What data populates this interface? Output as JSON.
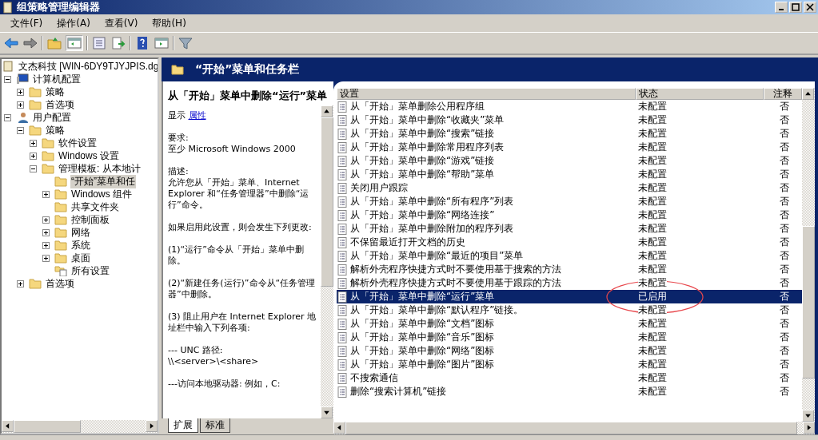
{
  "window": {
    "title": "组策略管理编辑器"
  },
  "menu": [
    "文件(F)",
    "操作(A)",
    "查看(V)",
    "帮助(H)"
  ],
  "tree": [
    {
      "label": "文杰科技 [WIN-6DY9TJYJPIS.dg",
      "kind": "scroll",
      "selected": false,
      "children": [
        {
          "label": "计算机配置",
          "kind": "computer",
          "expanded": true,
          "selected": false,
          "children": [
            {
              "label": "策略",
              "expanded": false,
              "selected": false
            },
            {
              "label": "首选项",
              "expanded": false,
              "selected": false
            }
          ]
        },
        {
          "label": "用户配置",
          "kind": "user",
          "expanded": true,
          "selected": false,
          "children": [
            {
              "label": "策略",
              "expanded": true,
              "selected": false,
              "children": [
                {
                  "label": "软件设置",
                  "expanded": false,
                  "selected": false
                },
                {
                  "label": "Windows 设置",
                  "expanded": false,
                  "selected": false
                },
                {
                  "label": "管理模板: 从本地计",
                  "expanded": true,
                  "selected": false,
                  "children": [
                    {
                      "label": "“开始”菜单和任",
                      "selected": true
                    },
                    {
                      "label": "Windows 组件",
                      "expanded": false,
                      "selected": false
                    },
                    {
                      "label": "共享文件夹",
                      "selected": false
                    },
                    {
                      "label": "控制面板",
                      "expanded": false,
                      "selected": false
                    },
                    {
                      "label": "网络",
                      "expanded": false,
                      "selected": false
                    },
                    {
                      "label": "系统",
                      "expanded": false,
                      "selected": false
                    },
                    {
                      "label": "桌面",
                      "expanded": false,
                      "selected": false
                    },
                    {
                      "label": "所有设置",
                      "kind": "allsettings",
                      "selected": false
                    }
                  ]
                }
              ]
            },
            {
              "label": "首选项",
              "expanded": false,
              "selected": false
            }
          ]
        }
      ]
    }
  ],
  "header": {
    "title": "“开始”菜单和任务栏"
  },
  "description": {
    "title": "从「开始」菜单中删除“运行”菜单",
    "show_label": "显示",
    "show_link": "属性",
    "paragraphs": [
      "要求:\n至少 Microsoft Windows 2000",
      "描述:\n允许您从「开始」菜单、Internet Explorer 和“任务管理器”中删除“运行”命令。",
      "如果启用此设置，则会发生下列更改:",
      "(1)“运行”命令从「开始」菜单中删除。",
      "(2)“新建任务(运行)”命令从“任务管理器”中删除。",
      "(3) 阻止用户在 Internet Explorer 地址栏中输入下列各项:",
      "--- UNC 路径:\n\\\\<server>\\<share>",
      "---访问本地驱动器: 例如，C:"
    ]
  },
  "table": {
    "columns": [
      "设置",
      "状态",
      "注释"
    ],
    "rows": [
      {
        "setting": "从「开始」菜单删除公用程序组",
        "state": "未配置",
        "comment": "否",
        "selected": false
      },
      {
        "setting": "从「开始」菜单中删除“收藏夹”菜单",
        "state": "未配置",
        "comment": "否",
        "selected": false
      },
      {
        "setting": "从「开始」菜单中删除“搜索”链接",
        "state": "未配置",
        "comment": "否",
        "selected": false
      },
      {
        "setting": "从「开始」菜单中删除常用程序列表",
        "state": "未配置",
        "comment": "否",
        "selected": false
      },
      {
        "setting": "从「开始」菜单中删除“游戏”链接",
        "state": "未配置",
        "comment": "否",
        "selected": false
      },
      {
        "setting": "从「开始」菜单中删除“帮助”菜单",
        "state": "未配置",
        "comment": "否",
        "selected": false
      },
      {
        "setting": "关闭用户跟踪",
        "state": "未配置",
        "comment": "否",
        "selected": false
      },
      {
        "setting": "从「开始」菜单中删除“所有程序”列表",
        "state": "未配置",
        "comment": "否",
        "selected": false
      },
      {
        "setting": "从「开始」菜单中删除“网络连接”",
        "state": "未配置",
        "comment": "否",
        "selected": false
      },
      {
        "setting": "从「开始」菜单中删除附加的程序列表",
        "state": "未配置",
        "comment": "否",
        "selected": false
      },
      {
        "setting": "不保留最近打开文档的历史",
        "state": "未配置",
        "comment": "否",
        "selected": false
      },
      {
        "setting": "从「开始」菜单中删除“最近的项目”菜单",
        "state": "未配置",
        "comment": "否",
        "selected": false
      },
      {
        "setting": "解析外壳程序快捷方式时不要使用基于搜索的方法",
        "state": "未配置",
        "comment": "否",
        "selected": false
      },
      {
        "setting": "解析外壳程序快捷方式时不要使用基于跟踪的方法",
        "state": "未配置",
        "comment": "否",
        "selected": false
      },
      {
        "setting": "从「开始」菜单中删除“运行”菜单",
        "state": "已启用",
        "comment": "否",
        "selected": true,
        "circled": true
      },
      {
        "setting": "从「开始」菜单中删除“默认程序”链接。",
        "state": "未配置",
        "comment": "否",
        "selected": false
      },
      {
        "setting": "从「开始」菜单中删除“文档”图标",
        "state": "未配置",
        "comment": "否",
        "selected": false
      },
      {
        "setting": "从「开始」菜单中删除“音乐”图标",
        "state": "未配置",
        "comment": "否",
        "selected": false
      },
      {
        "setting": "从「开始」菜单中删除“网络”图标",
        "state": "未配置",
        "comment": "否",
        "selected": false
      },
      {
        "setting": "从「开始」菜单中删除“图片”图标",
        "state": "未配置",
        "comment": "否",
        "selected": false
      },
      {
        "setting": "不搜索通信",
        "state": "未配置",
        "comment": "否",
        "selected": false
      },
      {
        "setting": "删除“搜索计算机”链接",
        "state": "未配置",
        "comment": "否",
        "selected": false
      }
    ]
  },
  "tabs": [
    {
      "label": "扩展",
      "selected": true
    },
    {
      "label": "标准",
      "selected": false
    }
  ]
}
